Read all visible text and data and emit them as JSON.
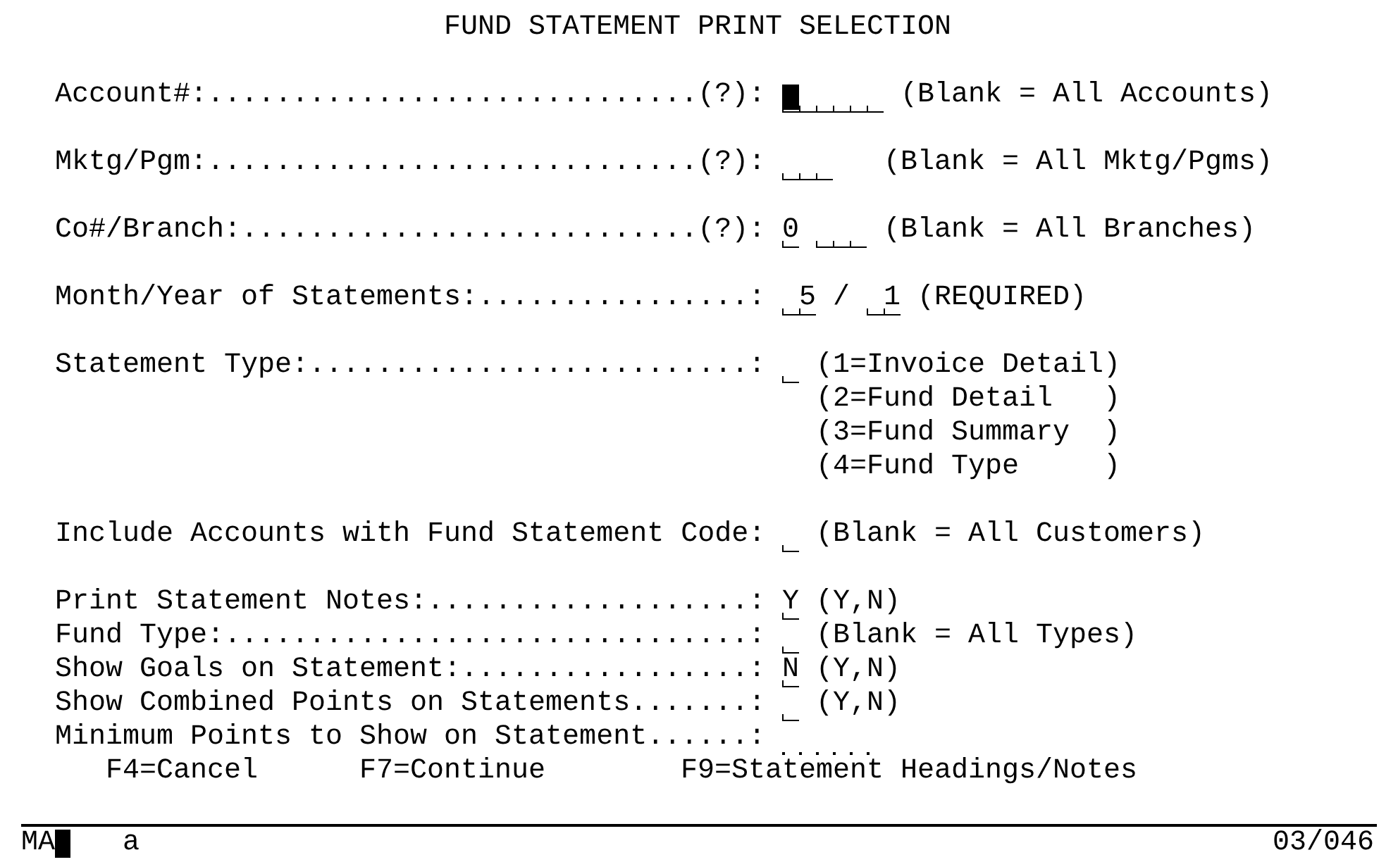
{
  "screen": {
    "title": "FUND STATEMENT PRINT SELECTION"
  },
  "prompts": [
    {
      "label": "Account#:.............................(?):",
      "fields": [
        {
          "kind": "text",
          "cursor": true
        }
      ],
      "hint": "(Blank = All Accounts)"
    },
    {
      "label": "Mktg/Pgm:.............................(?):",
      "fields": [
        {
          "kind": "text",
          "cursor": false
        }
      ],
      "hint": "(Blank = All Mktg/Pgms)"
    },
    {
      "label": "Co#/Branch:...........................(?):",
      "fields": [
        {
          "kind": "text",
          "value": "0",
          "cursor": false
        },
        {
          "kind": "text",
          "cursor": false
        }
      ],
      "hint": "(Blank = All Branches)"
    },
    {
      "label": "Month/Year of Statements:................:",
      "fields": [
        {
          "kind": "numeric",
          "value": "5",
          "cursor": false
        },
        {
          "kind": "numeric",
          "value": "1",
          "cursor": false
        }
      ],
      "separator": "/",
      "hint": "(REQUIRED)"
    },
    {
      "label": "Statement Type:..........................:",
      "fields": [
        {
          "kind": "text",
          "cursor": false
        }
      ],
      "options": [
        "(1=Invoice Detail)",
        "(2=Fund Detail   )",
        "(3=Fund Summary  )",
        "(4=Fund Type     )"
      ]
    },
    {
      "label": "Include Accounts with Fund Statement Code:",
      "fields": [
        {
          "kind": "text",
          "cursor": false
        }
      ],
      "hint": "(Blank = All Customers)"
    },
    {
      "label": "Print Statement Notes:...................:",
      "fields": [
        {
          "kind": "text",
          "value": "Y",
          "cursor": false
        }
      ],
      "hint": "(Y,N)"
    },
    {
      "label": "Fund Type:...............................:",
      "fields": [
        {
          "kind": "text",
          "cursor": false
        }
      ],
      "hint": "(Blank = All Types)"
    },
    {
      "label": "Show Goals on Statement:.................:",
      "fields": [
        {
          "kind": "text",
          "value": "N",
          "cursor": false
        }
      ],
      "hint": "(Y,N)"
    },
    {
      "label": "Show Combined Points on Statements.......:",
      "fields": [
        {
          "kind": "text",
          "cursor": false
        }
      ],
      "hint": "(Y,N)"
    },
    {
      "label": "Minimum Points to Show on Statement......:",
      "fields": [
        {
          "kind": "dotted",
          "cursor": false
        }
      ]
    }
  ],
  "function_keys": [
    "F4=Cancel",
    "F7=Continue",
    "F9=Statement Headings/Notes"
  ],
  "status_bar": {
    "system": "MA",
    "input": "a",
    "cursor_position": "03/046"
  }
}
